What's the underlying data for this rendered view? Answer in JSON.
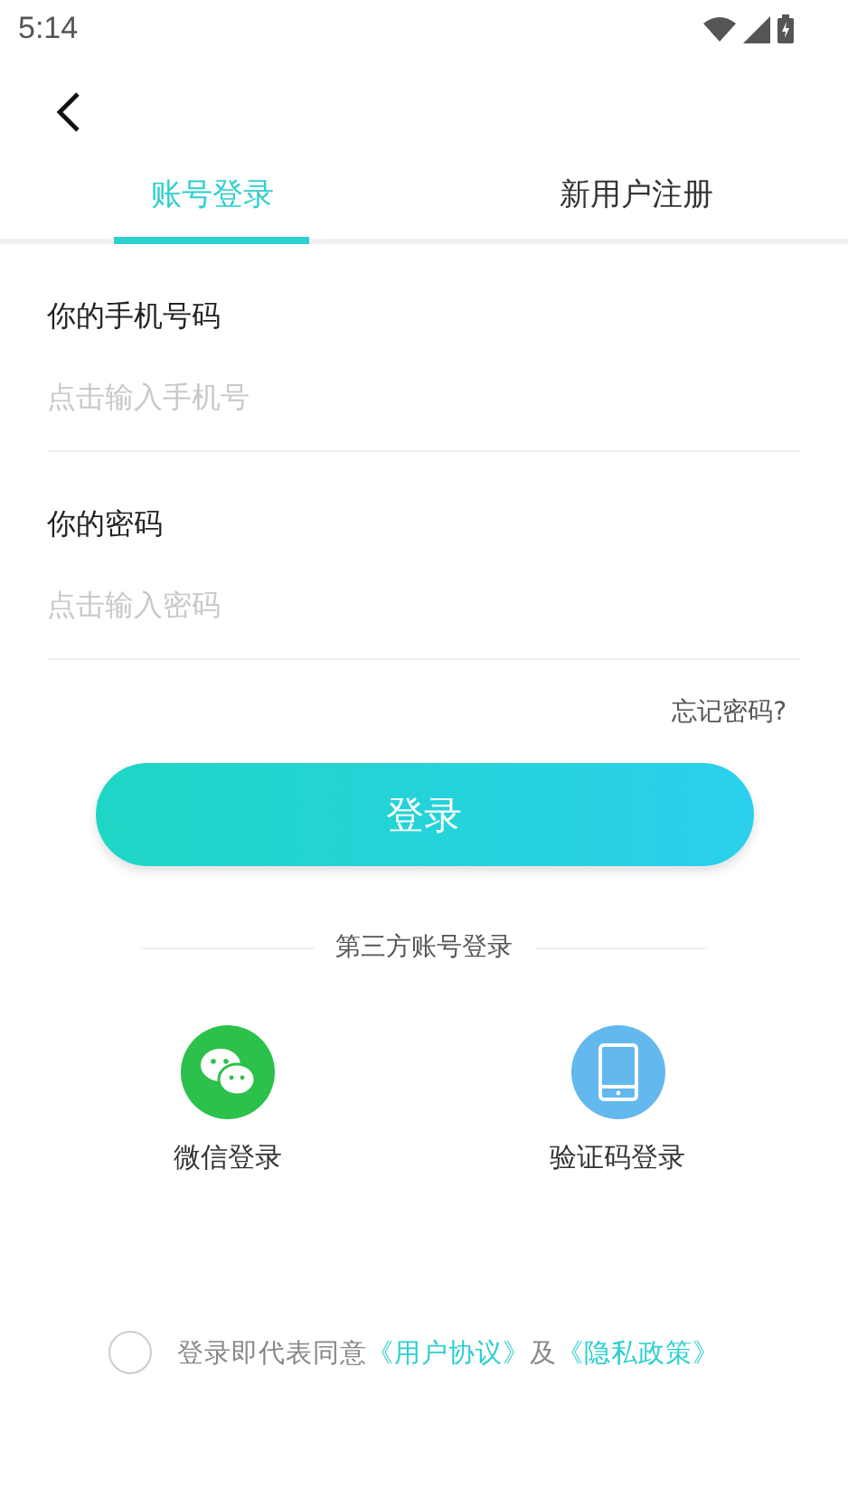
{
  "status_bar": {
    "time": "5:14"
  },
  "tabs": [
    {
      "label": "账号登录",
      "selected": true
    },
    {
      "label": "新用户注册",
      "selected": false
    }
  ],
  "fields": [
    {
      "label": "你的手机号码",
      "placeholder": "点击输入手机号"
    },
    {
      "label": "你的密码",
      "placeholder": "点击输入密码"
    }
  ],
  "forgot_password": "忘记密码?",
  "login_button": "登录",
  "third_party": {
    "title": "第三方账号登录",
    "options": [
      {
        "kind": "wechat",
        "label": "微信登录"
      },
      {
        "kind": "phone",
        "label": "验证码登录"
      }
    ]
  },
  "agreement": {
    "checked": false,
    "text": "登录即代表同意",
    "terms_link": "《用户协议》",
    "joiner": "及",
    "privacy_link": "《隐私政策》"
  }
}
